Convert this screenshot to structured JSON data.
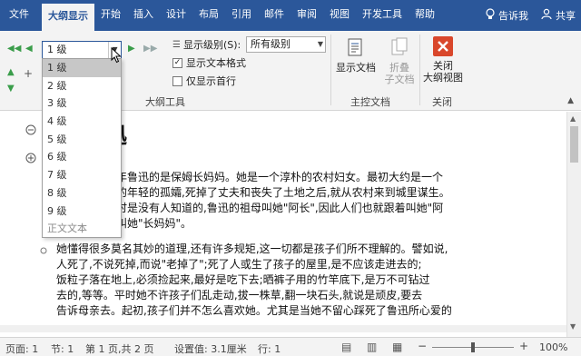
{
  "ribbon": {
    "tabs": [
      "文件",
      "大纲显示",
      "开始",
      "插入",
      "设计",
      "布局",
      "引用",
      "邮件",
      "审阅",
      "视图",
      "开发工具",
      "帮助"
    ],
    "tell_me": "告诉我",
    "share": "共享",
    "outline_tools": {
      "level_value": "1 级",
      "show_level_label": "显示级别(S):",
      "show_level_value": "所有级别",
      "show_text_format_label": "显示文本格式",
      "show_text_format_checked": true,
      "show_first_line_label": "仅显示首行",
      "show_first_line_checked": false,
      "group_label": "大纲工具"
    },
    "master_doc": {
      "show_doc": "显示文档",
      "collapse_subdoc_line1": "折叠",
      "collapse_subdoc_line2": "子文档",
      "group_label": "主控文档"
    },
    "close": {
      "line1": "关闭",
      "line2": "大纲视图",
      "group_label": "关闭"
    }
  },
  "level_dropdown": {
    "items": [
      "1 级",
      "2 级",
      "3 级",
      "4 级",
      "5 级",
      "6 级",
      "7 级",
      "8 级",
      "9 级",
      "正文文本"
    ],
    "selected_index": 0
  },
  "document": {
    "heading": "迅",
    "para1": [
      "勐年鲁迅的是保姆长妈妈。她是一个淳朴的农村妇女。最初大约是一个",
      "里的年轻的孤孀,死掉了丈夫和丧失了土地之后,就从农村来到城里谋生。",
      "拍时是没有人知道的,鲁迅的祖母叫她\"阿长\",因此人们也就跟着叫她\"阿",
      "们叫她\"长妈妈\"。"
    ],
    "para2": [
      "她懂得很多莫名其妙的道理,还有许多规矩,这一切都是孩子们所不理解的。譬如说,",
      "人死了,不说死掉,而说\"老掉了\";死了人或生了孩子的屋里,是不应该走进去的;",
      "饭粒子落在地上,必须捡起来,最好是吃下去;晒裤子用的竹竿底下,是万不可钻过",
      "去的,等等。平时她不许孩子们乱走动,拔一株草,翻一块石头,就说是顽皮,要去",
      "告诉母亲去。起初,孩子们并不怎么喜欢她。尤其是当她不留心踩死了鲁迅所心爱的"
    ]
  },
  "status_bar": {
    "page_setting": "页面: 1",
    "section": "节: 1",
    "page": "第 1 页,共 2 页",
    "position": "设置值: 3.1厘米",
    "line": "行: 1",
    "zoom": "100%"
  },
  "colors": {
    "accent": "#2b579a",
    "close_red": "#d9472b",
    "ribbon_bg": "#f3f3f3"
  }
}
